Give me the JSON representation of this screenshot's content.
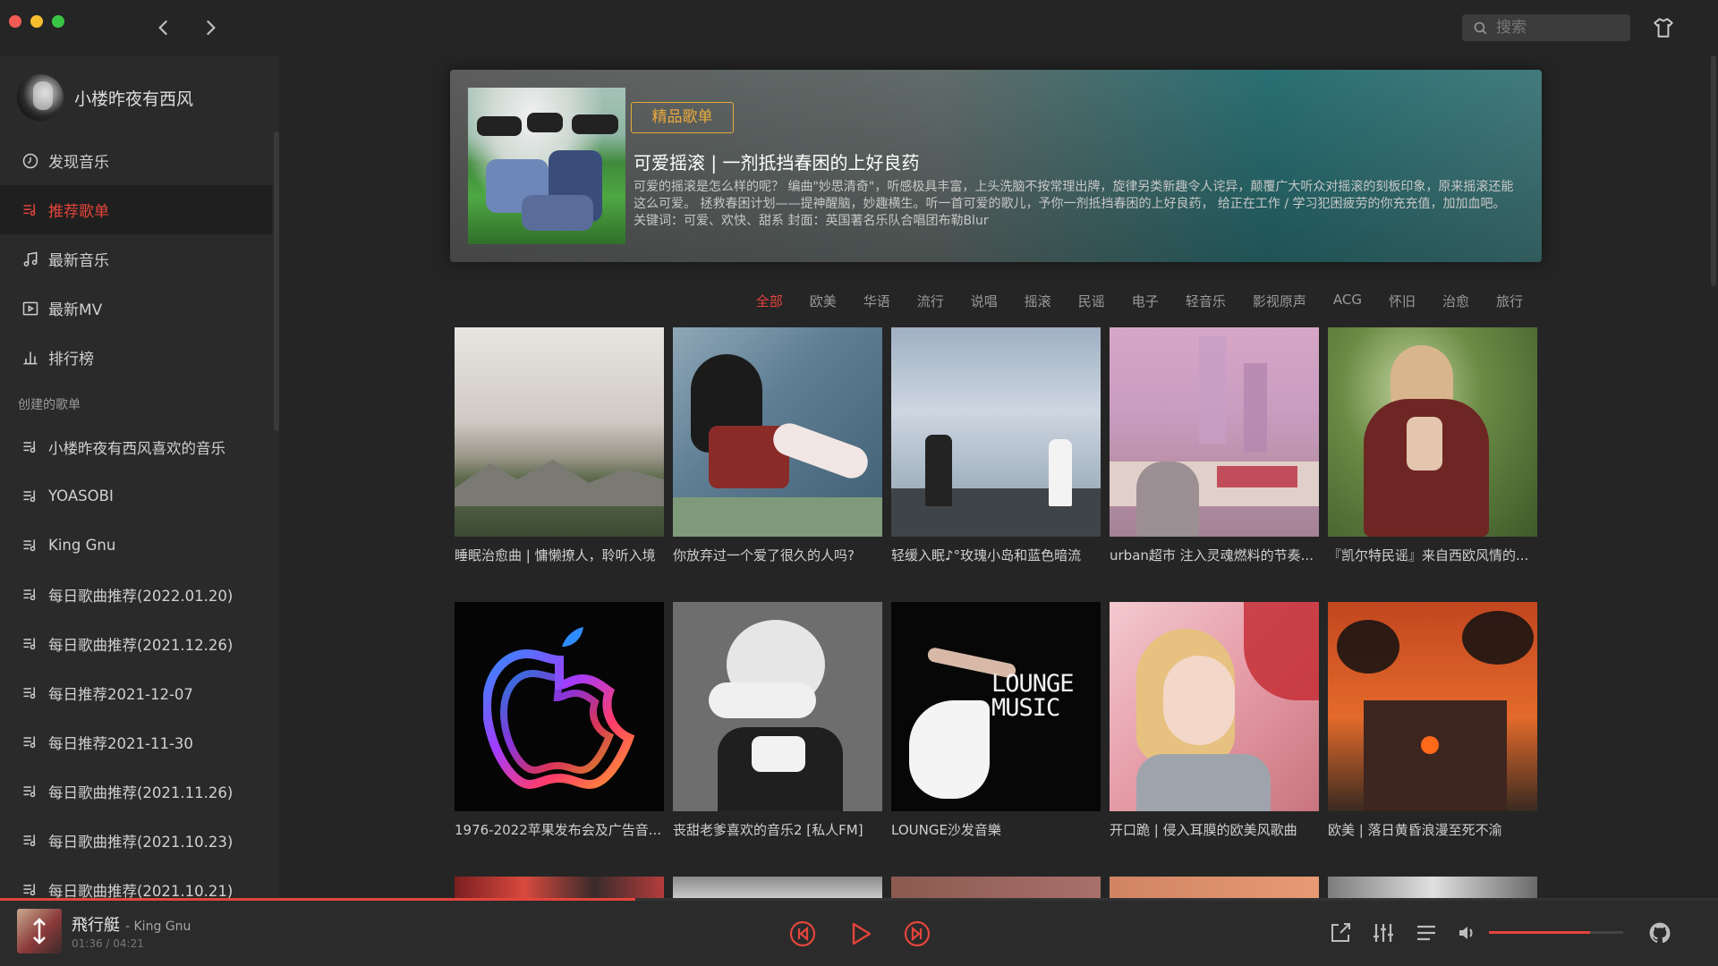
{
  "window": {
    "light_colors": [
      "#f25b56",
      "#f5be2f",
      "#39c545"
    ]
  },
  "search": {
    "placeholder": "搜索"
  },
  "sidebar": {
    "profile_name": "小楼昨夜有西风",
    "menu": [
      {
        "label": "发现音乐",
        "icon": "disc-icon"
      },
      {
        "label": "推荐歌单",
        "icon": "playlist-icon",
        "active": true
      },
      {
        "label": "最新音乐",
        "icon": "music-note-icon"
      },
      {
        "label": "最新MV",
        "icon": "video-icon"
      },
      {
        "label": "排行榜",
        "icon": "chart-icon"
      }
    ],
    "section_title": "创建的歌单",
    "playlists": [
      "小楼昨夜有西风喜欢的音乐",
      "YOASOBI",
      "King Gnu",
      "每日歌曲推荐(2022.01.20)",
      "每日歌曲推荐(2021.12.26)",
      "每日推荐2021-12-07",
      "每日推荐2021-11-30",
      "每日歌曲推荐(2021.11.26)",
      "每日歌曲推荐(2021.10.23)",
      "每日歌曲推荐(2021.10.21)"
    ]
  },
  "banner": {
    "badge": "精品歌单",
    "title": "可爱摇滚 | 一剂抵挡春困的上好良药",
    "description": "可爱的摇滚是怎么样的呢？ 编曲\"妙思清奇\"，听感极具丰富，上头洗脑不按常理出牌，旋律另类新趣令人诧异，颠覆广大听众对摇滚的刻板印象，原来摇滚还能这么可爱。 拯救春困计划——提神醒脑，妙趣横生。听一首可爱的歌儿，予你一剂抵挡春困的上好良药， 给正在工作 / 学习犯困疲劳的你充充值，加加血吧。 关键词：可爱、欢快、甜系 封面：英国著名乐队合唱团布勒Blur"
  },
  "tags": [
    "全部",
    "欧美",
    "华语",
    "流行",
    "说唱",
    "摇滚",
    "民谣",
    "电子",
    "轻音乐",
    "影视原声",
    "ACG",
    "怀旧",
    "治愈",
    "旅行"
  ],
  "active_tag": "全部",
  "playlists_grid": [
    {
      "title": "睡眠治愈曲 | 慵懒撩人，聆听入境"
    },
    {
      "title": "你放弃过一个爱了很久的人吗?"
    },
    {
      "title": "轻缓入眠♪°玫瑰小岛和蓝色暗流"
    },
    {
      "title": "urban超市 注入灵魂燃料的节奏..."
    },
    {
      "title": "『凯尔特民谣』来自西欧风情的..."
    },
    {
      "title": "1976-2022苹果发布会及广告音..."
    },
    {
      "title": "丧甜老爹喜欢的音乐2 [私人FM]"
    },
    {
      "title": "LOUNGE沙发音樂"
    },
    {
      "title": "开口跪 | 侵入耳膜的欧美风歌曲"
    },
    {
      "title": "欧美 | 落日黄昏浪漫至死不渝"
    }
  ],
  "cover_text": {
    "lounge_line1": "LOUNGE",
    "lounge_line2": "MUSIC"
  },
  "player": {
    "song_title": "飛行艇",
    "artist": "- King Gnu",
    "time": "01:36 / 04:21",
    "progress": 0.37,
    "volume": 0.75,
    "accent_color": "#e4453c"
  }
}
